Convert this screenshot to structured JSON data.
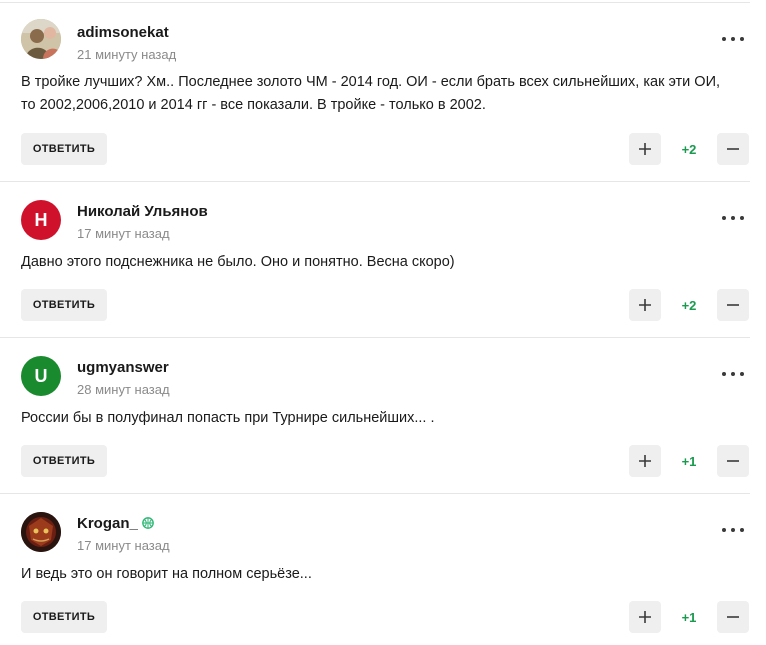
{
  "comments": [
    {
      "author": "adimsonekat",
      "time": "21 минуту назад",
      "text": "В тройке лучших? Хм.. Последнее золото ЧМ - 2014 год. ОИ - если брать всех сильнейших, как эти ОИ, то 2002,2006,2010 и 2014 гг - все показали. В тройке - только в 2002.",
      "reply_label": "ОТВЕТИТЬ",
      "score": "+2",
      "avatar": {
        "type": "photo",
        "letter": ""
      }
    },
    {
      "author": "Николай Ульянов",
      "time": "17 минут назад",
      "text": "Давно этого подснежника не было. Оно и понятно. Весна скоро)",
      "reply_label": "ОТВЕТИТЬ",
      "score": "+2",
      "avatar": {
        "type": "letter",
        "letter": "Н",
        "color": "#d0112b"
      }
    },
    {
      "author": "ugmyanswer",
      "time": "28 минут назад",
      "text": "России бы в полуфинал попасть при Турнире сильнейших... .",
      "reply_label": "ОТВЕТИТЬ",
      "score": "+1",
      "avatar": {
        "type": "letter",
        "letter": "U",
        "color": "#1a8a2e"
      }
    },
    {
      "author": "Krogan_",
      "time": "17 минут назад",
      "text": "И ведь это он говорит на полном серьёзе...",
      "reply_label": "ОТВЕТИТЬ",
      "score": "+1",
      "avatar": {
        "type": "photo",
        "letter": ""
      },
      "badge": "basketball-badge-icon"
    }
  ],
  "colors": {
    "score_positive": "#1a9a4f",
    "button_bg": "#efefef",
    "divider": "#e6e6e6",
    "badge": "#2bb673"
  }
}
